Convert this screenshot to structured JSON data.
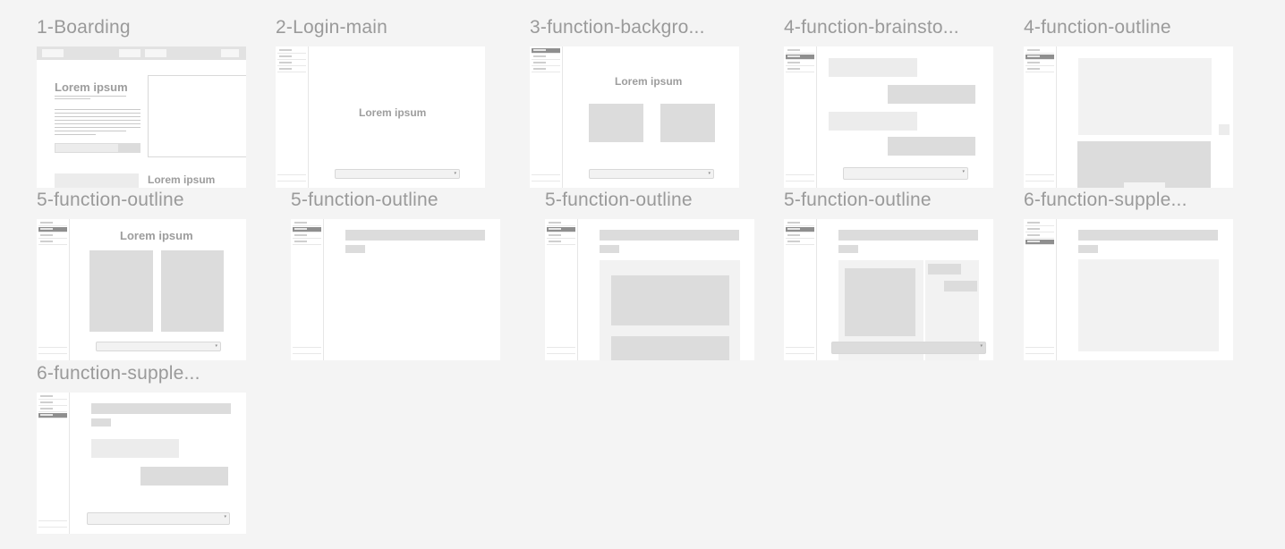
{
  "frames": [
    {
      "title": "1-Boarding",
      "heading": "Lorem ipsum",
      "subheading": "Lorem ipsum"
    },
    {
      "title": "2-Login-main",
      "heading": "Lorem ipsum"
    },
    {
      "title": "3-function-backgro...",
      "heading": "Lorem ipsum"
    },
    {
      "title": "4-function-brainsto..."
    },
    {
      "title": "4-function-outline"
    },
    {
      "title": "5-function-outline",
      "heading": "Lorem ipsum"
    },
    {
      "title": "5-function-outline"
    },
    {
      "title": "5-function-outline"
    },
    {
      "title": "5-function-outline"
    },
    {
      "title": "6-function-supple..."
    },
    {
      "title": "6-function-supple..."
    }
  ],
  "icons": {
    "dropdown": "chevron-down-icon"
  },
  "colors": {
    "canvas": "#f4f4f4",
    "frame": "#ffffff",
    "placeholder": "#dcdcdc",
    "active_nav": "#8e8e8e",
    "title": "#9a9a9a"
  }
}
